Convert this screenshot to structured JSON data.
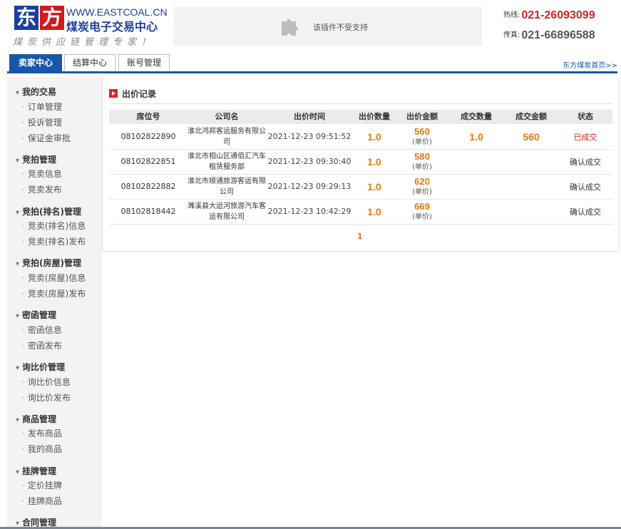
{
  "header": {
    "logo": {
      "char1": "东",
      "char2": "方",
      "url": "WWW.EASTCOAL.CN",
      "name": "煤炭电子交易中心",
      "slogan": "煤炭供应链管理专家！"
    },
    "plugin": {
      "text": "该插件不受支持",
      "icon": "puzzle-icon"
    },
    "hotline": {
      "label": "热线:",
      "number": "021-26093099"
    },
    "fax": {
      "label": "传真:",
      "number": "021-66896588"
    }
  },
  "tabs": [
    {
      "label": "卖家中心",
      "active": true
    },
    {
      "label": "结算中心",
      "active": false
    },
    {
      "label": "账号管理",
      "active": false
    }
  ],
  "home_link": "东方煤炭首页>>",
  "sidebar": [
    {
      "title": "我的交易",
      "items": [
        "订单管理",
        "投诉管理",
        "保证金审批"
      ]
    },
    {
      "title": "竞拍管理",
      "items": [
        "竞卖信息",
        "竞卖发布"
      ]
    },
    {
      "title": "竞拍(排名)管理",
      "items": [
        "竞卖(排名)信息",
        "竞卖(排名)发布"
      ]
    },
    {
      "title": "竞拍(房屋)管理",
      "items": [
        "竞卖(房屋)信息",
        "竞卖(房屋)发布"
      ]
    },
    {
      "title": "密函管理",
      "items": [
        "密函信息",
        "密函发布"
      ]
    },
    {
      "title": "询比价管理",
      "items": [
        "询比价信息",
        "询比价发布"
      ]
    },
    {
      "title": "商品管理",
      "items": [
        "发布商品",
        "我的商品"
      ]
    },
    {
      "title": "挂牌管理",
      "items": [
        "定价挂牌",
        "挂牌商品"
      ]
    },
    {
      "title": "合同管理",
      "items": []
    }
  ],
  "main": {
    "title": "出价记录",
    "columns": [
      "席位号",
      "公司名",
      "出价时间",
      "出价数量",
      "出价金额",
      "成交数量",
      "成交金额",
      "状态"
    ],
    "rows": [
      {
        "seat": "08102822890",
        "company": "淮北鸿邦客运服务有限公司",
        "time": "2021-12-23 09:51:52",
        "qty": "1.0",
        "amount": "560",
        "unit": "(单价)",
        "deal_qty": "1.0",
        "deal_amount": "560",
        "status": "已成交",
        "status_type": "done"
      },
      {
        "seat": "08102822851",
        "company": "淮北市相山区通佰汇汽车租赁服务部",
        "time": "2021-12-23 09:30:40",
        "qty": "1.0",
        "amount": "580",
        "unit": "(单价)",
        "deal_qty": "",
        "deal_amount": "",
        "status": "确认成交",
        "status_type": "confirm"
      },
      {
        "seat": "08102822882",
        "company": "淮北市顺通旅游客运有限公司",
        "time": "2021-12-23 09:29:13",
        "qty": "1.0",
        "amount": "620",
        "unit": "(单价)",
        "deal_qty": "",
        "deal_amount": "",
        "status": "确认成交",
        "status_type": "confirm"
      },
      {
        "seat": "08102818442",
        "company": "濉溪县大运河旅游汽车客运有限公司",
        "time": "2021-12-23 10:42:29",
        "qty": "1.0",
        "amount": "669",
        "unit": "(单价)",
        "deal_qty": "",
        "deal_amount": "",
        "status": "确认成交",
        "status_type": "confirm"
      }
    ],
    "pager": "1"
  }
}
